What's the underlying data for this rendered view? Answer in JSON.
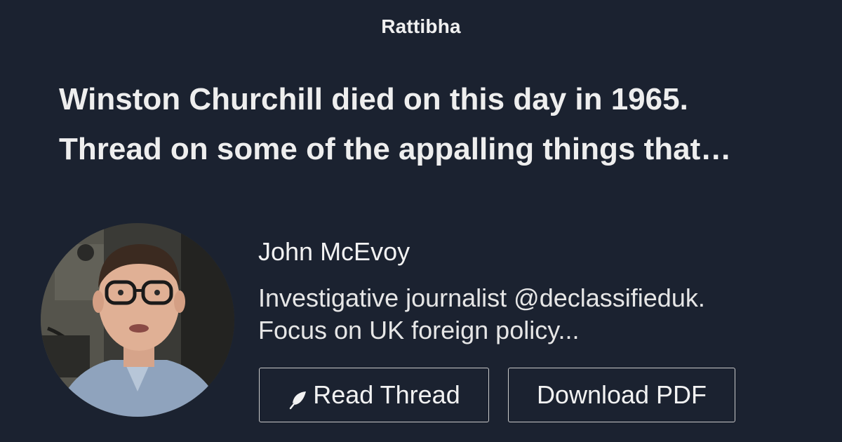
{
  "brand": {
    "name": "Rattibha"
  },
  "thread": {
    "title_lines": [
      "Winston Churchill died on this day in 1965.",
      "Thread on some of the appalling things that…"
    ]
  },
  "author": {
    "name": "John McEvoy",
    "bio_lines": [
      "Investigative journalist @declassifieduk.",
      "Focus on UK foreign policy..."
    ],
    "avatar_icon": "avatar-photo"
  },
  "actions": {
    "read_label": "Read Thread",
    "read_icon": "feather-icon",
    "pdf_label": "Download PDF"
  },
  "colors": {
    "background": "#1b2230",
    "text": "#eeeeee",
    "button_border": "#c9c9c9"
  }
}
